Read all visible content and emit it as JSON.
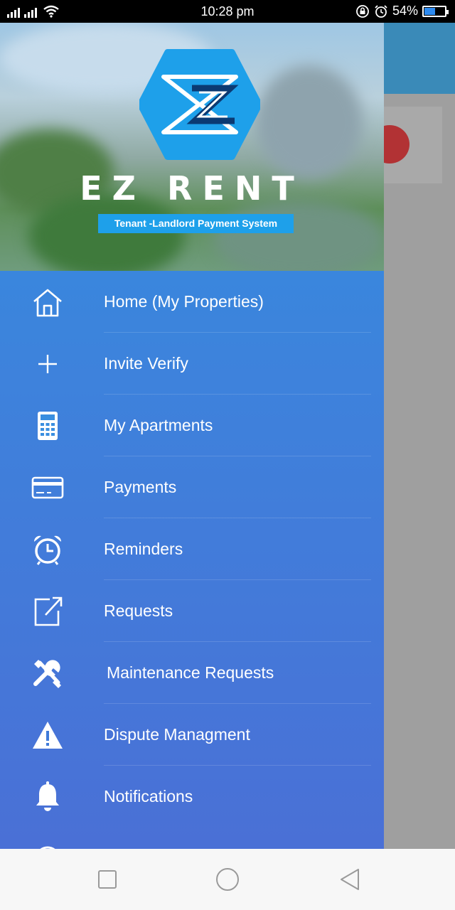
{
  "status_bar": {
    "time": "10:28 pm",
    "battery": "54%",
    "battery_level": 0.54
  },
  "drawer": {
    "brand": {
      "name": "EZ RENT",
      "tagline": "Tenant -Landlord Payment System",
      "logo_icon": "ez-hexagon-logo-icon"
    },
    "items": [
      {
        "label": "Home (My Properties)",
        "icon": "home-icon"
      },
      {
        "label": "Invite Verify",
        "icon": "plus-icon"
      },
      {
        "label": "My Apartments",
        "icon": "calculator-icon"
      },
      {
        "label": "Payments",
        "icon": "credit-card-icon"
      },
      {
        "label": "Reminders",
        "icon": "alarm-clock-icon"
      },
      {
        "label": "Requests",
        "icon": "external-link-icon"
      },
      {
        "label": " Maintenance Requests",
        "icon": "tools-icon"
      },
      {
        "label": "Dispute Managment",
        "icon": "warning-icon"
      },
      {
        "label": "Notifications",
        "icon": "bell-icon"
      }
    ]
  },
  "colors": {
    "drawer_top": "#2f8fe0",
    "drawer_bottom": "#4a70d6",
    "toolbar": "#3a8ab8",
    "fab": "#b23234",
    "logo": "#1ea0ea"
  },
  "navigation_bar": {
    "buttons": [
      "recents-square-icon",
      "home-circle-icon",
      "back-triangle-icon"
    ]
  }
}
